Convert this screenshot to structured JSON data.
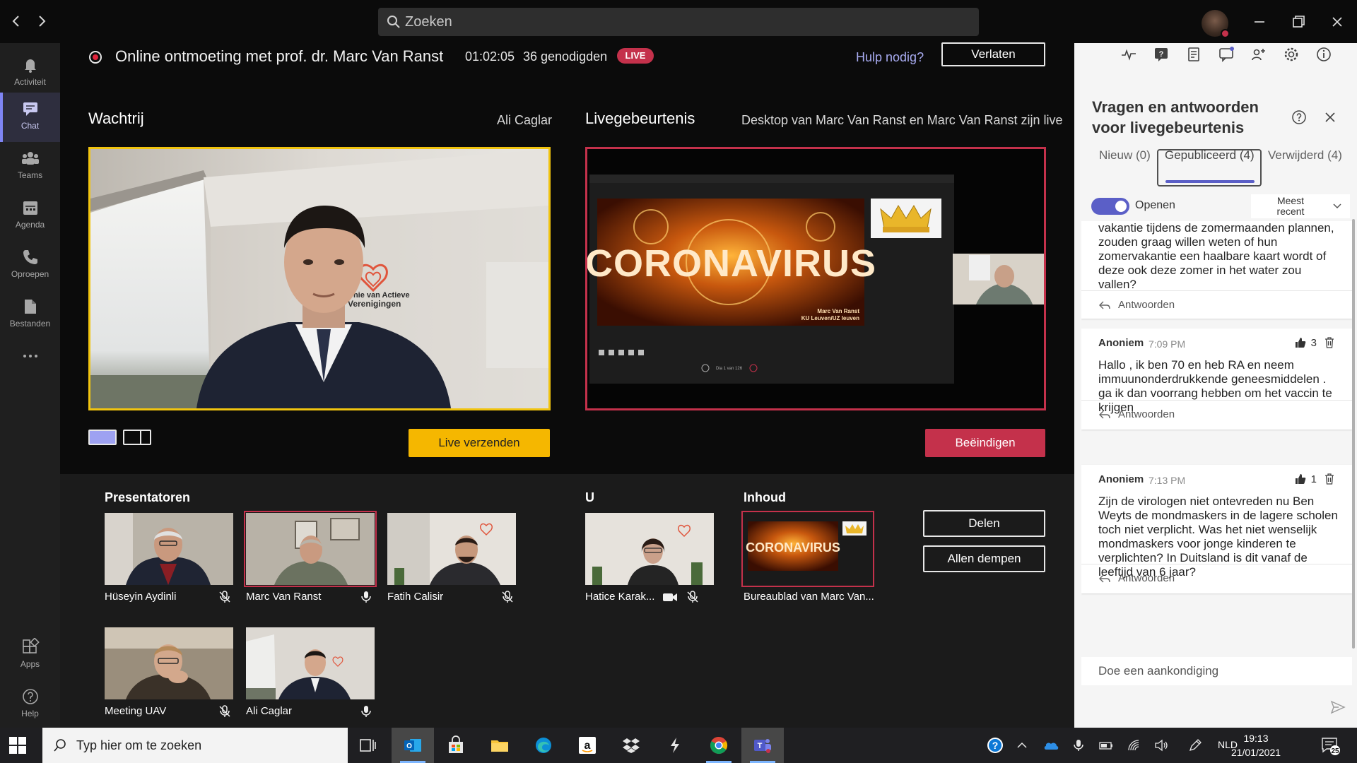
{
  "titlebar": {
    "search_placeholder": "Zoeken",
    "back_icon": "chevron-left-icon",
    "forward_icon": "chevron-right-icon"
  },
  "rail": {
    "items": [
      {
        "label": "Activiteit",
        "icon": "bell-icon"
      },
      {
        "label": "Chat",
        "icon": "chat-icon",
        "active": true
      },
      {
        "label": "Teams",
        "icon": "teams-icon"
      },
      {
        "label": "Agenda",
        "icon": "calendar-icon"
      },
      {
        "label": "Oproepen",
        "icon": "phone-icon"
      },
      {
        "label": "Bestanden",
        "icon": "files-icon"
      },
      {
        "label": "...",
        "icon": "more-icon"
      },
      {
        "label": "Apps",
        "icon": "apps-icon"
      },
      {
        "label": "Help",
        "icon": "help-icon"
      }
    ]
  },
  "meeting": {
    "title": "Online ontmoeting met prof. dr. Marc Van Ranst",
    "elapsed": "01:02:05",
    "guests": "36 genodigden",
    "live_badge": "LIVE",
    "help_link": "Hulp nodig?",
    "leave_label": "Verlaten"
  },
  "queue": {
    "label": "Wachtrij",
    "presenter": "Ali Caglar",
    "wall_logo_text_1": "Unie van Actieve",
    "wall_logo_text_2": "Verenigingen",
    "send_live_label": "Live verzenden"
  },
  "live_event": {
    "label": "Livegebeurtenis",
    "status": "Desktop van Marc Van Ranst en Marc Van Ranst zijn live",
    "slide_title": "CORONAVIRUS",
    "slide_author_1": "Marc Van Ranst",
    "slide_author_2": "KU Leuven/UZ leuven",
    "slide_counter": "Dia 1 van 126",
    "end_label": "Beëindigen"
  },
  "presenters": {
    "label": "Presentatoren",
    "tiles": [
      {
        "name": "Hüseyin Aydinli",
        "mic": "mic-off-icon"
      },
      {
        "name": "Marc Van Ranst",
        "mic": "mic-on-icon",
        "active": true
      },
      {
        "name": "Fatih Calisir",
        "mic": "mic-off-icon"
      },
      {
        "name": "Meeting UAV",
        "mic": "mic-off-icon"
      },
      {
        "name": "Ali Caglar",
        "mic": "mic-on-icon"
      }
    ]
  },
  "you": {
    "label": "U",
    "name": "Hatice Karak...",
    "icons": [
      "camera-icon",
      "mic-off-icon"
    ]
  },
  "content": {
    "label": "Inhoud",
    "name": "Bureaublad van Marc Van...",
    "slide_title": "CORONAVIRUS"
  },
  "actions": {
    "share_label": "Delen",
    "mute_all_label": "Allen dempen"
  },
  "qa": {
    "title_1": "Vragen en antwoorden",
    "title_2": "voor livegebeurtenis",
    "tabs": [
      {
        "label": "Nieuw (0)"
      },
      {
        "label": "Gepubliceerd (4)",
        "selected": true
      },
      {
        "label": "Verwijderd (4)"
      }
    ],
    "open_label": "Openen",
    "open_on": true,
    "sort_label_1": "Meest",
    "sort_label_2": "recent",
    "reply_label": "Antwoorden",
    "questions": [
      {
        "author": "",
        "time": "",
        "likes": "",
        "text": "het bijzonder mensen die hun jaarlijkse vakantie tijdens de zomermaanden plannen, zouden graag willen weten of hun zomervakantie een haalbare kaart wordt of deze ook deze zomer in het water zou vallen?"
      },
      {
        "author": "Anoniem",
        "time": "7:09 PM",
        "likes": "3",
        "text": "Hallo , ik ben 70 en heb RA en neem immuunonderdrukkende geneesmiddelen . ga ik dan voorrang hebben om het vaccin te krijgen"
      },
      {
        "author": "Anoniem",
        "time": "7:13 PM",
        "likes": "1",
        "text": "Zijn de virologen niet ontevreden nu Ben Weyts de mondmaskers in de lagere scholen toch niet verplicht. Was het niet wenselijk mondmaskers voor jonge kinderen te verplichten? In Duitsland is dit vanaf de leeftijd van 6 jaar?"
      }
    ],
    "announce_placeholder": "Doe een aankondiging"
  },
  "taskbar": {
    "search_placeholder": "Typ hier om te zoeken",
    "language": "NLD",
    "time": "19:13",
    "date": "21/01/2021",
    "notification_count": "25"
  },
  "colors": {
    "accent": "#5b5fc7",
    "live_red": "#c4314b",
    "queue_yellow": "#f5b700"
  }
}
